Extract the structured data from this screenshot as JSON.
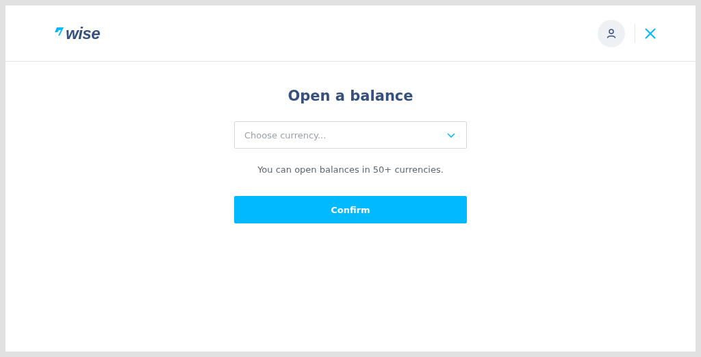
{
  "header": {
    "logo": "wise"
  },
  "title": "Open a balance",
  "currency_select": {
    "placeholder": "Choose currency..."
  },
  "hint": "You can open balances in 50+ currencies.",
  "confirm_button": "Confirm"
}
